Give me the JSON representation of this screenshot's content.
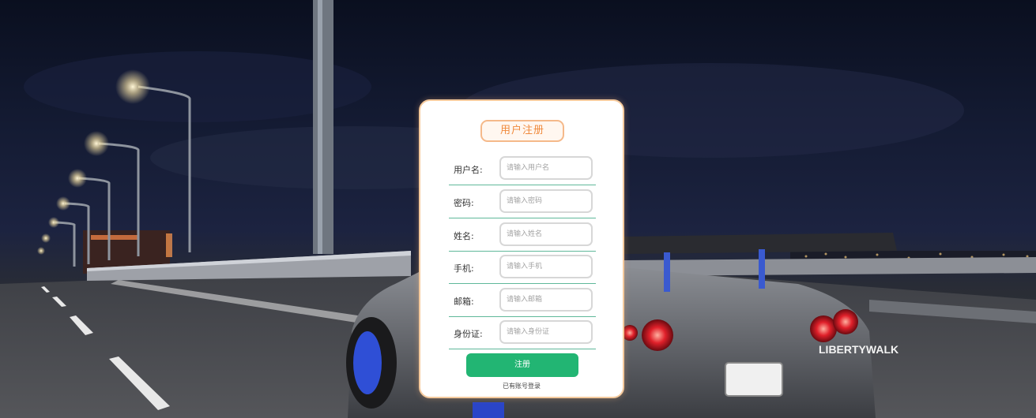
{
  "form": {
    "title": "用户注册",
    "fields": [
      {
        "label": "用户名:",
        "placeholder": "请输入用户名"
      },
      {
        "label": "密码:",
        "placeholder": "请输入密码"
      },
      {
        "label": "姓名:",
        "placeholder": "请输入姓名"
      },
      {
        "label": "手机:",
        "placeholder": "请输入手机"
      },
      {
        "label": "邮箱:",
        "placeholder": "请输入邮箱"
      },
      {
        "label": "身份证:",
        "placeholder": "请输入身份证"
      }
    ],
    "submit_label": "注册",
    "login_link": "已有账号登录"
  },
  "background": {
    "plate_text": "LIBERTYWALK"
  },
  "colors": {
    "title": "#f08a3c",
    "submit": "#22b573",
    "underline": "#5fb89a"
  }
}
